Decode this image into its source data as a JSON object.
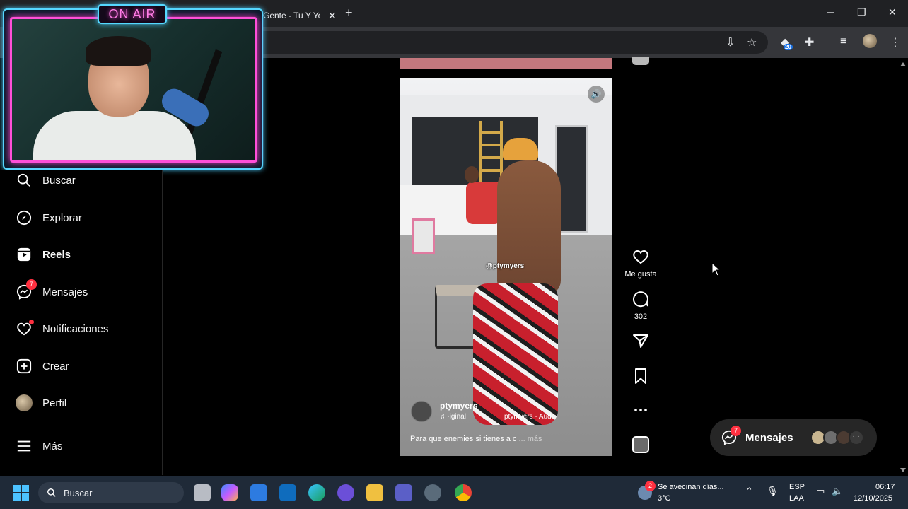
{
  "browser": {
    "tab_title": "Gente - Tu Y Yo",
    "tab_close": "✕",
    "new_tab": "+",
    "window_controls": {
      "minimize": "─",
      "restore": "❐",
      "close": "✕"
    },
    "extension_badge": "20"
  },
  "overlay": {
    "on_air": "ON AIR"
  },
  "sidebar": {
    "items": [
      {
        "label": "Buscar",
        "icon": "search-icon"
      },
      {
        "label": "Explorar",
        "icon": "compass-icon"
      },
      {
        "label": "Reels",
        "icon": "reels-icon",
        "active": true
      },
      {
        "label": "Mensajes",
        "icon": "messenger-icon",
        "badge": "7"
      },
      {
        "label": "Notificaciones",
        "icon": "heart-icon"
      },
      {
        "label": "Crear",
        "icon": "plus-square-icon"
      },
      {
        "label": "Perfil",
        "icon": "avatar"
      },
      {
        "label": "Más",
        "icon": "menu-icon"
      }
    ]
  },
  "reel": {
    "watermark": "@ptymyers",
    "username": "ptymyers",
    "audio_original": "♫ ·iginal",
    "audio_credit": "ptymyers · Audi",
    "caption": "Para que enemies si tienes a c",
    "caption_more": "... más"
  },
  "actions": {
    "like_label": "Me gusta",
    "comment_count": "302"
  },
  "messages_pill": {
    "label": "Mensajes",
    "badge": "7"
  },
  "taskbar": {
    "search_label": "Buscar",
    "weather_badge": "2",
    "weather_title": "Se avecinan días...",
    "weather_temp": "3°C",
    "lang_1": "ESP",
    "lang_2": "LAA",
    "time": "06:17",
    "date": "12/10/2025"
  }
}
